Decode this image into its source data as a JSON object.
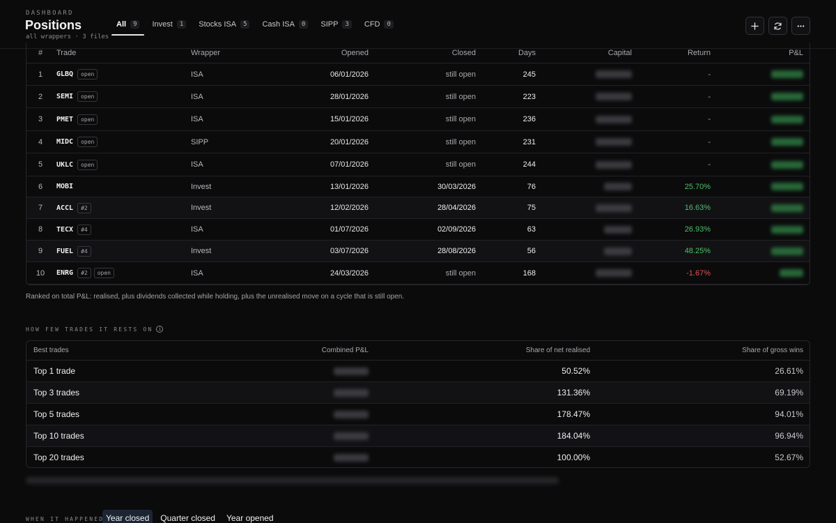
{
  "header": {
    "kicker": "DASHBOARD",
    "title": "Positions",
    "subtitle": "all wrappers · 3 files"
  },
  "tabs": [
    {
      "label": "All",
      "count": "9"
    },
    {
      "label": "Invest",
      "count": "1"
    },
    {
      "label": "Stocks ISA",
      "count": "5"
    },
    {
      "label": "Cash ISA",
      "count": "0"
    },
    {
      "label": "SIPP",
      "count": "3"
    },
    {
      "label": "CFD",
      "count": "0"
    }
  ],
  "toolbar": {
    "add_icon": "plus-icon",
    "refresh_icon": "refresh-icon",
    "more_icon": "more-dots-icon"
  },
  "positions": {
    "columns": {
      "num": "#",
      "trade": "Trade",
      "wrapper": "Wrapper",
      "opened": "Opened",
      "closed": "Closed",
      "days": "Days",
      "capital": "Capital",
      "return": "Return",
      "pnl": "P&L"
    },
    "rows": [
      {
        "num": "1",
        "ticker": "GLBQ",
        "tags": [
          "open"
        ],
        "wrapper": "ISA",
        "opened": "06/01/2026",
        "closed": "still open",
        "days": "245",
        "return": "-"
      },
      {
        "num": "2",
        "ticker": "SEMI",
        "tags": [
          "open"
        ],
        "wrapper": "ISA",
        "opened": "28/01/2026",
        "closed": "still open",
        "days": "223",
        "return": "-"
      },
      {
        "num": "3",
        "ticker": "PMET",
        "tags": [
          "open"
        ],
        "wrapper": "ISA",
        "opened": "15/01/2026",
        "closed": "still open",
        "days": "236",
        "return": "-"
      },
      {
        "num": "4",
        "ticker": "MIDC",
        "tags": [
          "open"
        ],
        "wrapper": "SIPP",
        "opened": "20/01/2026",
        "closed": "still open",
        "days": "231",
        "return": "-"
      },
      {
        "num": "5",
        "ticker": "UKLC",
        "tags": [
          "open"
        ],
        "wrapper": "ISA",
        "opened": "07/01/2026",
        "closed": "still open",
        "days": "244",
        "return": "-"
      },
      {
        "num": "6",
        "ticker": "MOBI",
        "tags": [],
        "wrapper": "Invest",
        "opened": "13/01/2026",
        "closed": "30/03/2026",
        "days": "76",
        "return": "25.70%"
      },
      {
        "num": "7",
        "ticker": "ACCL",
        "tags": [
          "#2"
        ],
        "wrapper": "Invest",
        "opened": "12/02/2026",
        "closed": "28/04/2026",
        "days": "75",
        "return": "16.63%"
      },
      {
        "num": "8",
        "ticker": "TECX",
        "tags": [
          "#4"
        ],
        "wrapper": "ISA",
        "opened": "01/07/2026",
        "closed": "02/09/2026",
        "days": "63",
        "return": "26.93%"
      },
      {
        "num": "9",
        "ticker": "FUEL",
        "tags": [
          "#4"
        ],
        "wrapper": "Invest",
        "opened": "03/07/2026",
        "closed": "28/08/2026",
        "days": "56",
        "return": "48.25%"
      },
      {
        "num": "10",
        "ticker": "ENRG",
        "tags": [
          "#2",
          "open"
        ],
        "wrapper": "ISA",
        "opened": "24/03/2026",
        "closed": "still open",
        "days": "168",
        "return": "-1.67%"
      }
    ]
  },
  "note": "Ranked on total P&L: realised, plus dividends collected while holding, plus the unrealised move on a cycle that is still open.",
  "concentration": {
    "section_label": "HOW FEW TRADES IT RESTS ON",
    "columns": {
      "label": "Best trades",
      "combined": "Combined P&L",
      "net": "Share of net realised",
      "gross": "Share of gross wins"
    },
    "rows": [
      {
        "label": "Top 1 trade",
        "net": "50.52%",
        "gross": "26.61%"
      },
      {
        "label": "Top 3 trades",
        "net": "131.36%",
        "gross": "69.19%"
      },
      {
        "label": "Top 5 trades",
        "net": "178.47%",
        "gross": "94.01%"
      },
      {
        "label": "Top 10 trades",
        "net": "184.04%",
        "gross": "96.94%"
      },
      {
        "label": "Top 20 trades",
        "net": "100.00%",
        "gross": "52.67%"
      }
    ]
  },
  "when": {
    "section_label": "WHEN IT HAPPENED",
    "options": [
      "Year closed",
      "Quarter closed",
      "Year opened"
    ],
    "selected": "Year closed"
  },
  "colors": {
    "positive": "#4fbf6a",
    "negative": "#e05353"
  }
}
